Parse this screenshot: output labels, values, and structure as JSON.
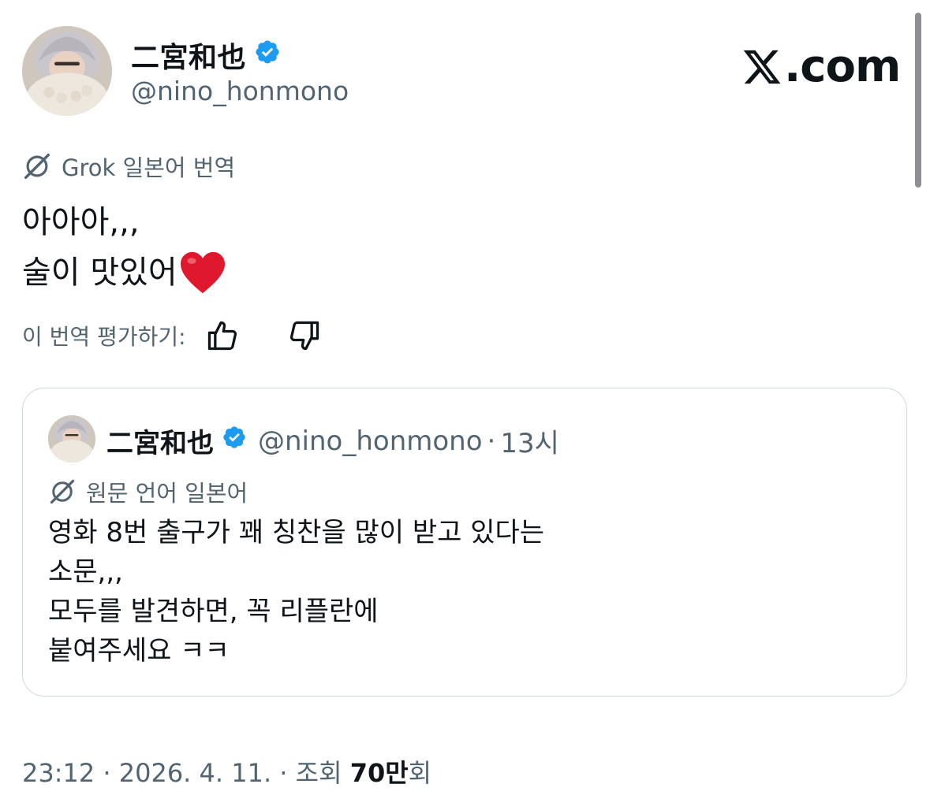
{
  "author": {
    "display_name": "二宮和也",
    "handle": "@nino_honmono",
    "verified": true
  },
  "brand": {
    "text": ".com",
    "icon": "x-logo-icon"
  },
  "translation": {
    "label": "Grok 일본어 번역",
    "lines": [
      "아아아,,,",
      "술이 맛있어"
    ],
    "emoji": "heart-emoji",
    "rate_label": "이 번역 평가하기:"
  },
  "quote": {
    "display_name": "二宮和也",
    "handle": "@nino_honmono",
    "separator": "·",
    "time": "13시",
    "original_label": "원문 언어 일본어",
    "lines": [
      "영화 8번 출구가 꽤 칭찬을 많이 받고 있다는",
      "소문,,,",
      "모두를 발견하면, 꼭 리플란에",
      "붙여주세요 ㅋㅋ"
    ]
  },
  "meta": {
    "time": "23:12",
    "sep": "·",
    "date": "2026. 4. 11.",
    "views_label": "조회",
    "views_count": "70만",
    "views_suffix": "회"
  },
  "colors": {
    "verified": "#1d9bf0",
    "secondary_text": "#536471",
    "border": "#cfd9de",
    "heart": "#e0182d"
  }
}
